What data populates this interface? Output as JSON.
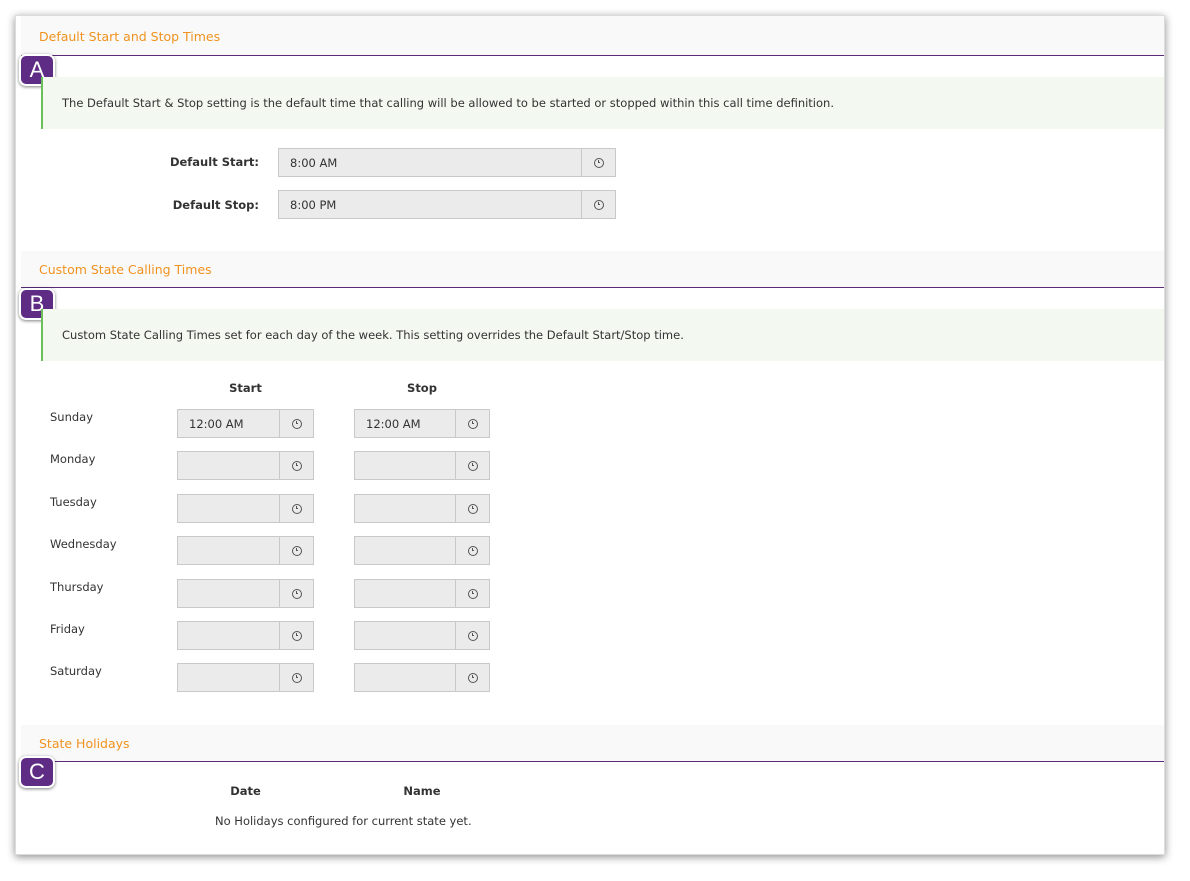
{
  "sections": {
    "default": {
      "title": "Default Start and Stop Times",
      "badge": "A",
      "info": "The Default Start & Stop setting is the default time that calling will be allowed to be started or stopped within this call time definition.",
      "start_label": "Default Start:",
      "start_value": "8:00 AM",
      "stop_label": "Default Stop:",
      "stop_value": "8:00 PM"
    },
    "custom": {
      "title": "Custom State Calling Times",
      "badge": "B",
      "info": "Custom State Calling Times set for each day of the week. This setting overrides the Default Start/Stop time.",
      "start_header": "Start",
      "stop_header": "Stop",
      "days": [
        {
          "name": "Sunday",
          "start": "12:00 AM",
          "stop": "12:00 AM"
        },
        {
          "name": "Monday",
          "start": "",
          "stop": ""
        },
        {
          "name": "Tuesday",
          "start": "",
          "stop": ""
        },
        {
          "name": "Wednesday",
          "start": "",
          "stop": ""
        },
        {
          "name": "Thursday",
          "start": "",
          "stop": ""
        },
        {
          "name": "Friday",
          "start": "",
          "stop": ""
        },
        {
          "name": "Saturday",
          "start": "",
          "stop": ""
        }
      ]
    },
    "holidays": {
      "title": "State Holidays",
      "badge": "C",
      "date_header": "Date",
      "name_header": "Name",
      "empty_message": "No Holidays configured for current state yet."
    }
  },
  "icons": {
    "clock": "clock-icon"
  },
  "colors": {
    "section_title": "#f0921e",
    "badge": "#5e2c84",
    "divider": "#5b2a7a",
    "info_border": "#6bbf59",
    "info_bg": "#f3f8f0"
  }
}
